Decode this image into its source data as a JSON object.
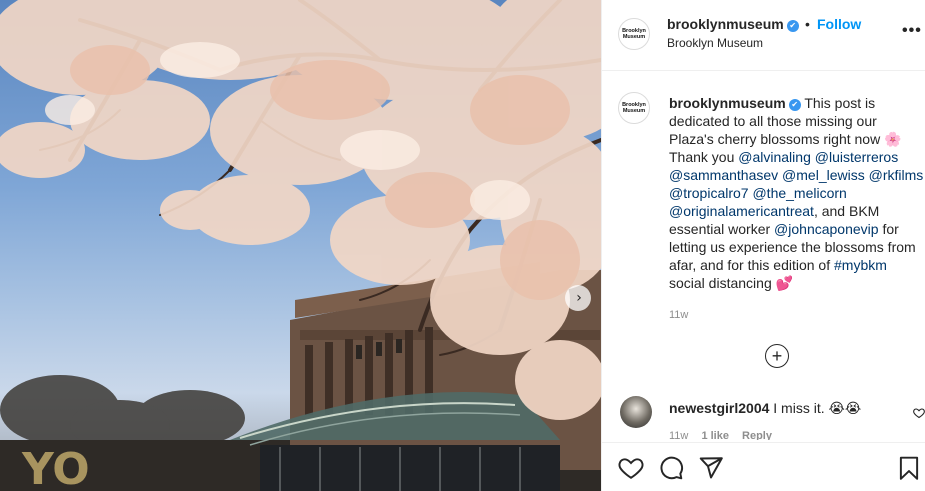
{
  "photo": {
    "overlay_text": "YO",
    "next_arrow": "chevron-right-icon"
  },
  "header": {
    "avatar_text": "Brooklyn\nMuseum",
    "username": "brooklynmuseum",
    "verified_icon": "✔",
    "separator": "•",
    "follow_label": "Follow",
    "location": "Brooklyn Museum",
    "more_label": "•••"
  },
  "caption": {
    "username": "brooklynmuseum",
    "text_1": "This post is dedicated to all those missing our Plaza's cherry blossoms right now 🌸 Thank you ",
    "mentions": [
      "@alvinaling",
      "@luisterreros",
      "@sammanthasev",
      "@mel_lewiss",
      "@rkfilms",
      "@tropicalro7",
      "@the_melicorn",
      "@originalamericantreat"
    ],
    "text_2": ", and BKM essential worker ",
    "mention_worker": "@johncaponevip",
    "text_3": " for letting us experience the blossoms from afar, and for this edition of ",
    "hashtag": "#mybkm",
    "text_4": " social distancing 💕",
    "timestamp": "11w"
  },
  "load_more_label": "+",
  "comment": {
    "username": "newestgirl2004",
    "text": "I miss it. 😭😭",
    "time": "11w",
    "likes": "1 like",
    "reply": "Reply"
  },
  "colors": {
    "link": "#00376b",
    "follow": "#0095f6",
    "verified": "#3897f0",
    "meta": "#8e8e8e"
  }
}
